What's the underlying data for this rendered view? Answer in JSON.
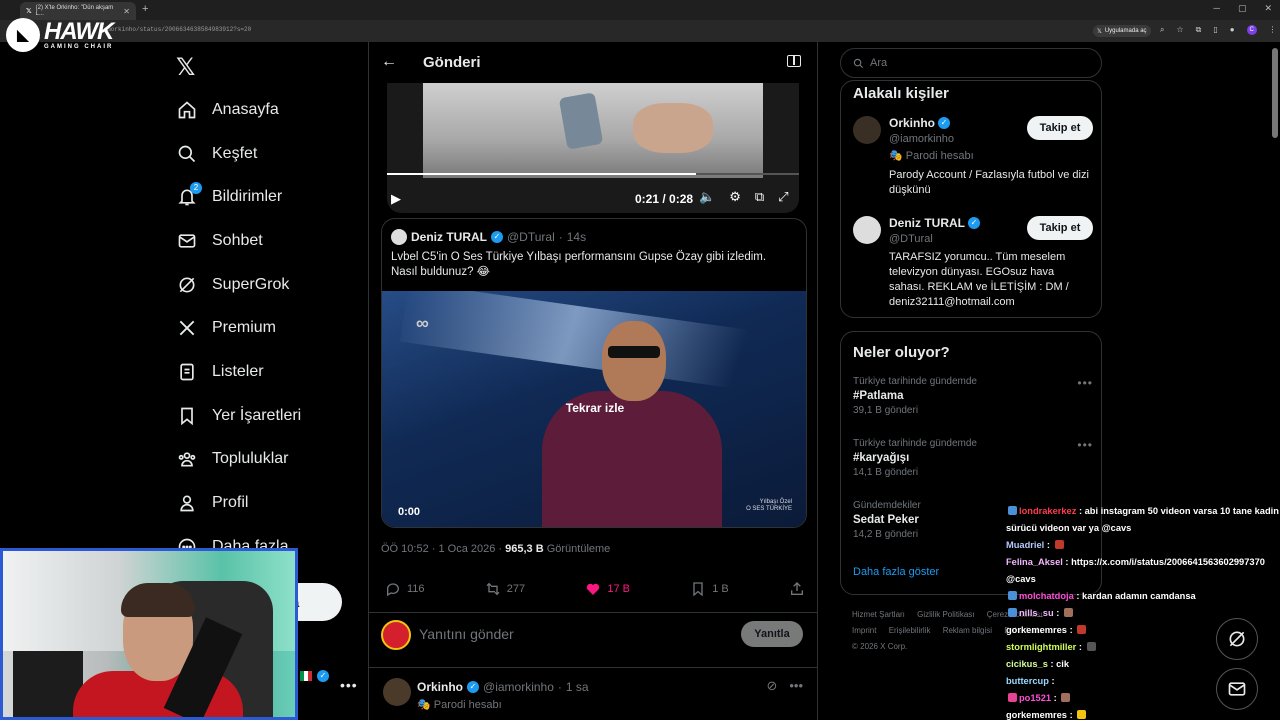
{
  "browser": {
    "tab_title": "(2) X'te Orkinho: \"Dün akşam L...",
    "url": "iamorkinho/status/2006634638584983912?s=20",
    "app_button": "Uygulamada aç"
  },
  "overlay_logo": {
    "title": "HAWK",
    "subtitle": "GAMING CHAIR"
  },
  "nav": {
    "items": [
      {
        "label": "Anasayfa"
      },
      {
        "label": "Keşfet"
      },
      {
        "label": "Bildirimler",
        "badge": "2"
      },
      {
        "label": "Sohbet"
      },
      {
        "label": "SuperGrok"
      },
      {
        "label": "Premium"
      },
      {
        "label": "Listeler"
      },
      {
        "label": "Yer İşaretleri"
      },
      {
        "label": "Topluluklar"
      },
      {
        "label": "Profil"
      },
      {
        "label": "Daha fazla"
      }
    ],
    "post_button": "a"
  },
  "header": {
    "title": "Gönderi"
  },
  "video1": {
    "time": "0:21 / 0:28",
    "progress": 0.75
  },
  "quoted": {
    "name": "Deniz TURAL",
    "handle": "@DTural",
    "time": "14s",
    "text": "Lvbel C5'in O Ses Türkiye Yılbaşı performansını Gupse Özay gibi izledim. Nasıl buldunuz? 😂",
    "replay_label": "Tekrar izle",
    "video_time": "0:00",
    "video_logo": "Yılbaşı Özel\nO SES TÜRKİYE"
  },
  "meta": {
    "time": "ÖÖ 10:52 · 1 Oca 2026 · ",
    "views": "965,3 B",
    "views_label": " Görüntüleme"
  },
  "actions": {
    "replies": "116",
    "reposts": "277",
    "likes": "17 B",
    "bookmarks": "1 B"
  },
  "reply_box": {
    "placeholder": "Yanıtını gönder",
    "button": "Yanıtla"
  },
  "reply_tweet": {
    "name": "Orkinho",
    "handle": "@iamorkinho",
    "time": "1 sa",
    "sub": "Parodi hesabı"
  },
  "search": {
    "placeholder": "Ara"
  },
  "related": {
    "title": "Alakalı kişiler",
    "people": [
      {
        "name": "Orkinho",
        "handle": "@iamorkinho",
        "parody": "Parodi hesabı",
        "bio": "Parody Account / Fazlasıyla futbol ve dizi düşkünü",
        "follow": "Takip et"
      },
      {
        "name": "Deniz TURAL",
        "handle": "@DTural",
        "bio": "TARAFSIZ yorumcu.. Tüm meselem televizyon dünyası. EGOsuz hava sahası. REKLAM ve İLETİŞİM : DM / deniz32111@hotmail.com",
        "follow": "Takip et"
      }
    ]
  },
  "trends": {
    "title": "Neler oluyor?",
    "items": [
      {
        "category": "Türkiye tarihinde gündemde",
        "name": "#Patlama",
        "count": "39,1 B gönderi"
      },
      {
        "category": "Türkiye tarihinde gündemde",
        "name": "#karyağışı",
        "count": "14,1 B gönderi"
      },
      {
        "category": "Gündemdekiler",
        "name": "Sedat Peker",
        "count": "14,2 B gönderi"
      }
    ],
    "show_more": "Daha fazla göster"
  },
  "footer": {
    "links": [
      "Hizmet Şartları",
      "Gizlilik Politikası",
      "Çerez Politikası",
      "Imprint",
      "Erişilebilirlik",
      "Reklam bilgisi",
      "Daha fazla ..."
    ],
    "copyright": "© 2026 X Corp."
  },
  "chat": {
    "messages": [
      {
        "user": "londrakerkez",
        "text": " : abi instagram 50 videon varsa 10 tane kadin"
      },
      {
        "user": "",
        "text": "sürücü videon var ya  @cavs"
      },
      {
        "user": "Muadriel",
        "text": " : "
      },
      {
        "user": "Felina_Aksel",
        "text": " : https://x.com/i/status/2006641563602997370"
      },
      {
        "user": "",
        "text": "@cavs"
      },
      {
        "user": "molchatdoja",
        "text": " : kardan adamın camdansa"
      },
      {
        "user": "nills_su",
        "text": " : "
      },
      {
        "user": "gorkememres",
        "text": " : "
      },
      {
        "user": "stormlightmiller",
        "text": " : "
      },
      {
        "user": "cicikus_s",
        "text": " : cik"
      },
      {
        "user": "buttercup",
        "text": " : "
      },
      {
        "user": "po1521",
        "text": " : "
      },
      {
        "user": "gorkememres",
        "text": " : "
      }
    ]
  },
  "colors": {
    "accent": "#1d9bf0",
    "like": "#f91880",
    "background": "#000000"
  }
}
